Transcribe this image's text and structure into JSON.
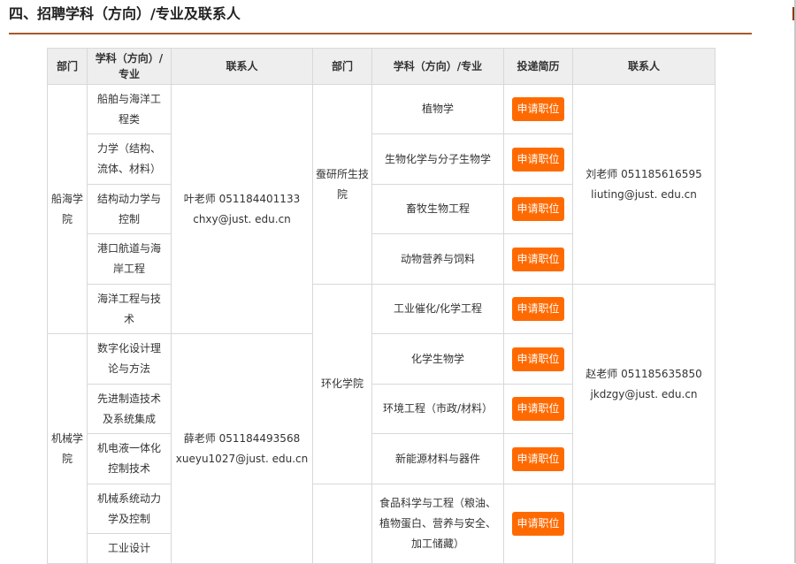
{
  "section_title": "四、招聘学科（方向）/专业及联系人",
  "headers": {
    "dept": "部门",
    "subject_narrow": "学科（方向）/专业",
    "contact": "联系人",
    "dept2": "部门",
    "subject2": "学科（方向）/专业",
    "apply": "投递简历",
    "contact2": "联系人"
  },
  "button_label": "申请职位",
  "left_groups": [
    {
      "dept": "船海学院",
      "contact_name_phone": "叶老师 051184401133",
      "contact_email": "chxy@just. edu.cn",
      "subjects": [
        "船舶与海洋工程类",
        "力学（结构、流体、材料）",
        "结构动力学与控制",
        "港口航道与海岸工程",
        "海洋工程与技术"
      ]
    },
    {
      "dept": "机械学院",
      "contact_name_phone": "薛老师 051184493568",
      "contact_email": "xueyu1027@just. edu.cn",
      "subjects": [
        "数字化设计理论与方法",
        "先进制造技术及系统集成",
        "机电液一体化控制技术",
        "机械系统动力学及控制",
        "工业设计"
      ]
    }
  ],
  "right_groups": [
    {
      "dept": "蚕研所生技院",
      "contact_name_phone": "刘老师 051185616595",
      "contact_email": "liuting@just. edu.cn",
      "subjects": [
        "植物学",
        "生物化学与分子生物学",
        "畜牧生物工程",
        "动物营养与饲料"
      ]
    },
    {
      "dept": "环化学院",
      "contact_name_phone": "赵老师 051185635850",
      "contact_email": "jkdzgy@just. edu.cn",
      "subjects": [
        "工业催化/化学工程",
        "化学生物学",
        "环境工程（市政/材料）",
        "新能源材料与器件"
      ]
    },
    {
      "dept": "",
      "contact_name_phone": "",
      "contact_email": "",
      "subjects": [
        "食品科学与工程（粮油、植物蛋白、营养与安全、加工储藏）"
      ]
    }
  ],
  "colors": {
    "accent": "#ff6a00",
    "rule": "#a65a2a",
    "header_bg": "#eeeeee",
    "border": "#d8d8d8"
  }
}
